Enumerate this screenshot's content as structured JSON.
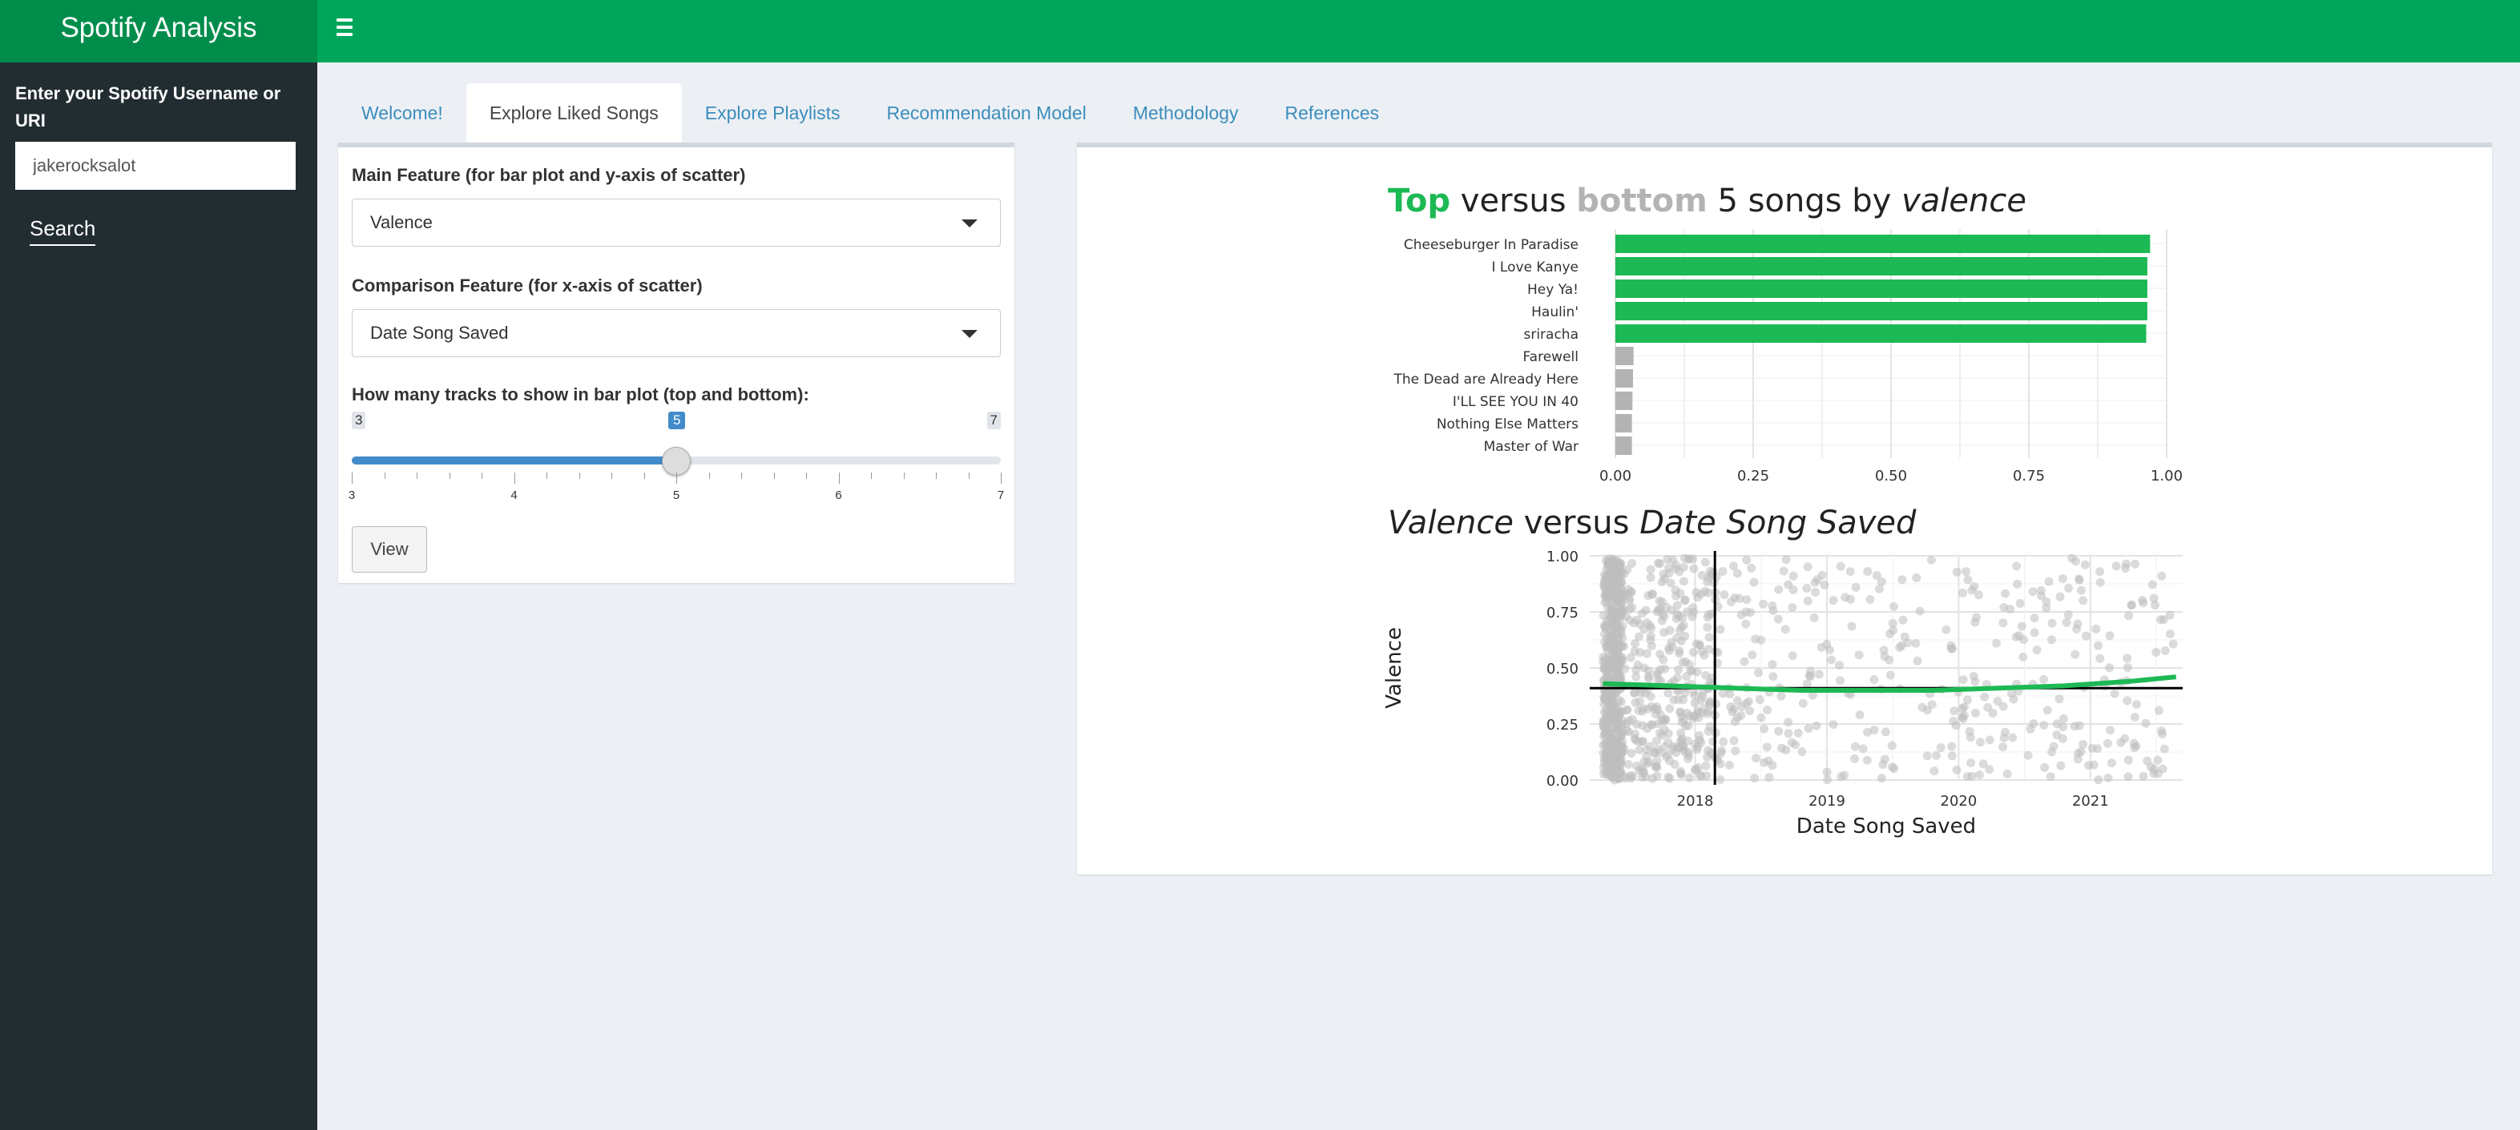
{
  "app": {
    "title": "Spotify Analysis"
  },
  "header": {
    "menu_icon": "hamburger-menu-icon"
  },
  "sidebar": {
    "input_label": "Enter your Spotify Username or URI",
    "input_value": "jakerocksalot",
    "search_label": "Search"
  },
  "tabs": [
    {
      "label": "Welcome!",
      "active": false
    },
    {
      "label": "Explore Liked Songs",
      "active": true
    },
    {
      "label": "Explore Playlists",
      "active": false
    },
    {
      "label": "Recommendation Model",
      "active": false
    },
    {
      "label": "Methodology",
      "active": false
    },
    {
      "label": "References",
      "active": false
    }
  ],
  "controls": {
    "main_feature_label": "Main Feature (for bar plot and y-axis of scatter)",
    "main_feature_value": "Valence",
    "comparison_feature_label": "Comparison Feature (for x-axis of scatter)",
    "comparison_feature_value": "Date Song Saved",
    "slider_label": "How many tracks to show in bar plot (top and bottom):",
    "slider": {
      "min": 3,
      "max": 7,
      "value": 5,
      "ticks": [
        3,
        4,
        5,
        6,
        7
      ]
    },
    "view_label": "View"
  },
  "colors": {
    "accent": "#00a65a",
    "top": "#1db954",
    "bottom": "#b3b3b3",
    "sidebar": "#222d32"
  },
  "chart_data": [
    {
      "type": "bar",
      "orientation": "horizontal",
      "title_parts": {
        "top": "Top",
        "versus1": " versus ",
        "bottom": "bottom",
        "rest": " 5 songs by ",
        "feature": "valence"
      },
      "categories": [
        "Cheeseburger In Paradise",
        "I Love Kanye",
        "Hey Ya!",
        "Haulin'",
        "sriracha",
        "Farewell",
        "The Dead are Already Here",
        "I'LL SEE YOU IN 40",
        "Nothing Else Matters",
        "Master of War"
      ],
      "values": [
        0.97,
        0.965,
        0.965,
        0.965,
        0.963,
        0.033,
        0.032,
        0.031,
        0.03,
        0.03
      ],
      "groups": [
        "top",
        "top",
        "top",
        "top",
        "top",
        "bottom",
        "bottom",
        "bottom",
        "bottom",
        "bottom"
      ],
      "xlim": [
        0,
        1
      ],
      "xticks": [
        "0.00",
        "0.25",
        "0.50",
        "0.75",
        "1.00"
      ],
      "grid": true
    },
    {
      "type": "scatter",
      "title_parts": {
        "y": "Valence",
        "versus": " versus ",
        "x": "Date Song Saved"
      },
      "xlabel": "Date Song Saved",
      "ylabel": "Valence",
      "xticks": [
        "2018",
        "2019",
        "2020",
        "2021"
      ],
      "yticks": [
        "0.00",
        "0.25",
        "0.50",
        "0.75",
        "1.00"
      ],
      "xlim": [
        2017.2,
        2021.7
      ],
      "ylim": [
        0,
        1
      ],
      "point_count": 1200,
      "x_range": [
        2017.3,
        2021.65
      ],
      "y_range": [
        0.0,
        0.99
      ],
      "trend": {
        "x": [
          2017.3,
          2017.8,
          2018.3,
          2018.8,
          2019.3,
          2019.8,
          2020.3,
          2020.8,
          2021.3,
          2021.65
        ],
        "y": [
          0.43,
          0.42,
          0.41,
          0.4,
          0.4,
          0.4,
          0.41,
          0.42,
          0.44,
          0.46
        ]
      },
      "reference_lines": {
        "x": 2018.15,
        "y": 0.41
      },
      "grid": true
    }
  ]
}
